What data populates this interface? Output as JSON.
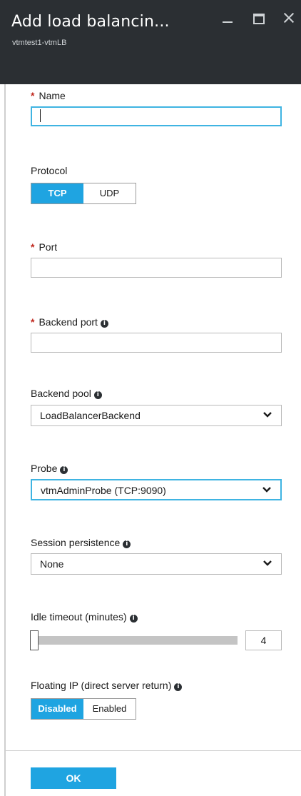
{
  "blade": {
    "title": "Add load balancin...",
    "subtitle": "vtmtest1-vtmLB",
    "window_controls": [
      "minimize-icon",
      "maximize-icon",
      "close-icon"
    ]
  },
  "required_marker": "*",
  "info_glyph": "i",
  "fields": {
    "name": {
      "label": "Name",
      "value": ""
    },
    "protocol": {
      "label": "Protocol",
      "options": [
        "TCP",
        "UDP"
      ],
      "selected": "TCP"
    },
    "port": {
      "label": "Port",
      "value": ""
    },
    "backend_port": {
      "label": "Backend port",
      "value": ""
    },
    "backend_pool": {
      "label": "Backend pool",
      "value": "LoadBalancerBackend"
    },
    "probe": {
      "label": "Probe",
      "value": "vtmAdminProbe (TCP:9090)"
    },
    "session_persistence": {
      "label": "Session persistence",
      "value": "None"
    },
    "idle_timeout": {
      "label": "Idle timeout (minutes)",
      "value": "4",
      "slider_fraction": 0.0
    },
    "floating_ip": {
      "label": "Floating IP (direct server return)",
      "options": [
        "Disabled",
        "Enabled"
      ],
      "selected": "Disabled"
    }
  },
  "footer": {
    "ok_label": "OK"
  },
  "colors": {
    "header_bg": "#2b2f33",
    "accent": "#1fa4e1",
    "focus_border": "#3fb4e2",
    "required": "#c0281e"
  }
}
